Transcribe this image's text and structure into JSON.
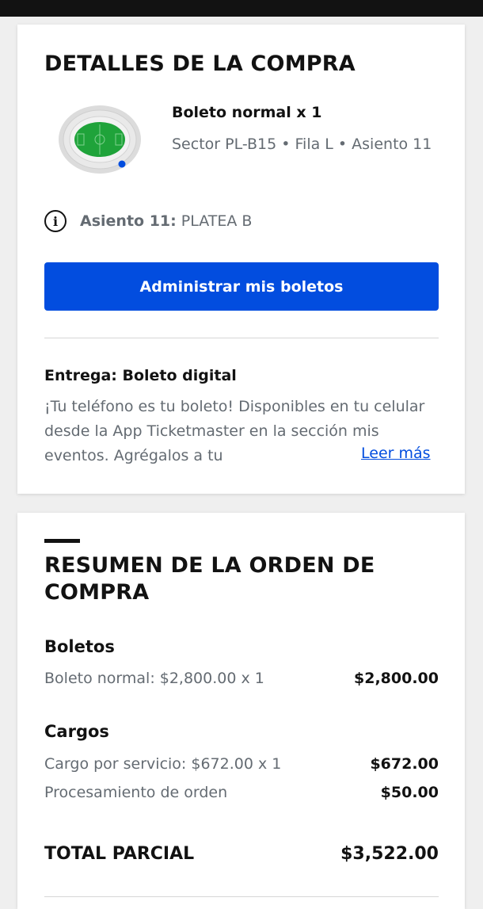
{
  "purchase_details": {
    "heading": "DETALLES DE LA COMPRA",
    "ticket_title": "Boleto normal x 1",
    "ticket_location": "Sector PL-B15 • Fila L • Asiento 11",
    "seat_label": "Asiento 11:",
    "seat_value": "PLATEA B",
    "manage_button": "Administrar mis boletos",
    "delivery_title": "Entrega: Boleto digital",
    "delivery_body": "¡Tu teléfono es tu boleto! Disponibles en tu celular desde la App Ticketmaster en la sección mis eventos. Agrégalos a tu",
    "read_more": "Leer más"
  },
  "order_summary": {
    "heading": "RESUMEN DE LA ORDEN DE COMPRA",
    "tickets_label": "Boletos",
    "ticket_line": {
      "label": "Boleto normal: $2,800.00 x 1",
      "amount": "$2,800.00"
    },
    "charges_label": "Cargos",
    "charge_lines": [
      {
        "label": "Cargo por servicio: $672.00 x 1",
        "amount": "$672.00"
      },
      {
        "label": "Procesamiento de orden",
        "amount": "$50.00"
      }
    ],
    "total_label": "TOTAL PARCIAL",
    "total_amount": "$3,522.00"
  },
  "icons": {
    "info": "info-icon",
    "stadium": "stadium-map-icon"
  },
  "colors": {
    "primary": "#024ddf",
    "text_dark": "#121212",
    "text_muted": "#646b72",
    "field_green": "#1fa33a"
  }
}
